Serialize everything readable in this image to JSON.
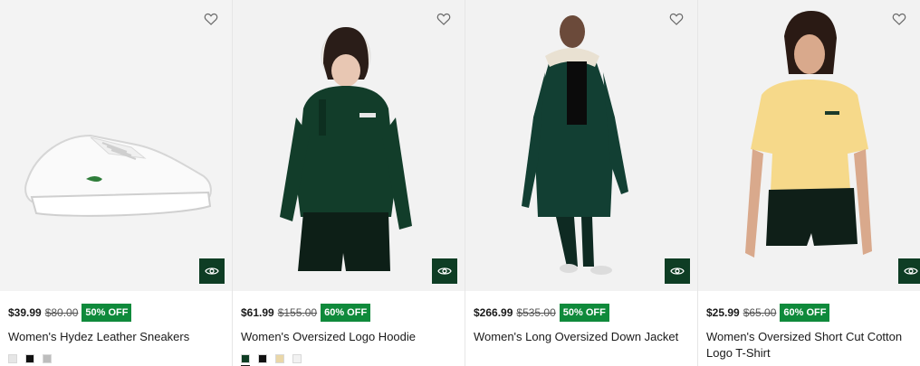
{
  "products": [
    {
      "price": "$39.99",
      "old_price": "$80.00",
      "badge": "50% OFF",
      "name": "Women's Hydez Leather Sneakers",
      "swatches": [
        "#e6e6e6",
        "#111111",
        "#bdbdbd"
      ]
    },
    {
      "price": "$61.99",
      "old_price": "$155.00",
      "badge": "60% OFF",
      "name": "Women's Oversized Logo Hoodie",
      "swatches": [
        "#0e3d24",
        "#111111",
        "#ead7a8",
        "#f2f2f2"
      ]
    },
    {
      "price": "$266.99",
      "old_price": "$535.00",
      "badge": "50% OFF",
      "name": "Women's Long Oversized Down Jacket",
      "swatches": []
    },
    {
      "price": "$25.99",
      "old_price": "$65.00",
      "badge": "60% OFF",
      "name": "Women's Oversized Short Cut Cotton Logo T-Shirt",
      "swatches": []
    }
  ],
  "icons": {
    "wishlist": "heart-outline-icon",
    "quick_view": "eye-icon"
  },
  "colors": {
    "badge": "#0f8a3b",
    "quick_view_bg": "#0e3d24",
    "image_bg": "#f3f3f3"
  }
}
